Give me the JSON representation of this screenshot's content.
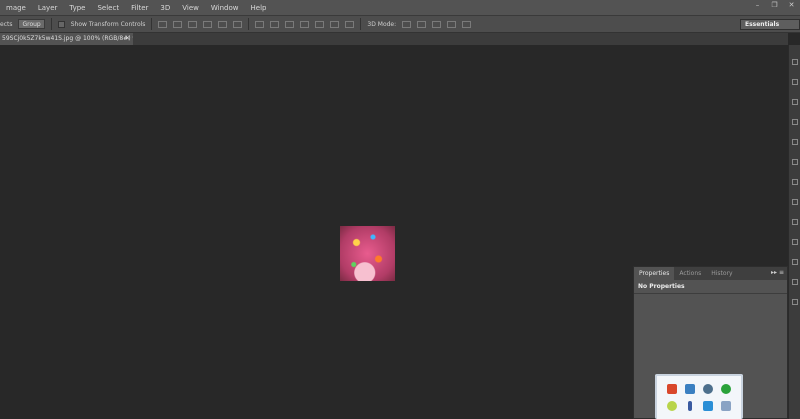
{
  "menu": [
    "mage",
    "Layer",
    "Type",
    "Select",
    "Filter",
    "3D",
    "View",
    "Window",
    "Help"
  ],
  "window_controls": {
    "minimize": "–",
    "restore": "❐",
    "close": "✕"
  },
  "options": {
    "auto_select_label": "ects",
    "group_value": "Group",
    "show_transform_label": "Show Transform Controls",
    "mode_3d_label": "3D Mode:"
  },
  "workspace": "Essentials",
  "document_tab": {
    "title": "59SCj0k5Z7k5w41S.jpg @ 100% (RGB/8#)",
    "modified": "*",
    "close": "✕"
  },
  "panel": {
    "tabs": [
      "Properties",
      "Actions",
      "History"
    ],
    "controls": "▸▸ ≡",
    "content": "No Properties"
  },
  "tray_icons": [
    {
      "name": "speaker-icon",
      "color": "#d9472b"
    },
    {
      "name": "network-icon",
      "color": "#3a7fc1"
    },
    {
      "name": "sync-icon",
      "color": "#4d6f8c"
    },
    {
      "name": "utorrent-icon",
      "color": "#2aa23a"
    },
    {
      "name": "lime-icon",
      "color": "#b8d44a"
    },
    {
      "name": "usb-icon",
      "color": "#3a5aa0"
    },
    {
      "name": "p-icon",
      "color": "#2b8fd6"
    },
    {
      "name": "user-icon",
      "color": "#8aa3c4"
    }
  ]
}
